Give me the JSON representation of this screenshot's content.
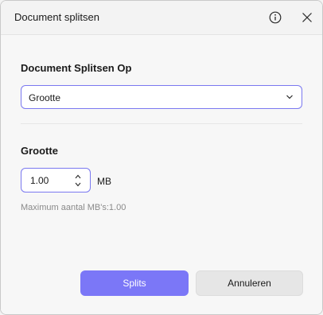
{
  "dialog": {
    "title": "Document splitsen",
    "icons": {
      "info": "info-circle-icon",
      "close": "close-icon"
    }
  },
  "split_by": {
    "label": "Document Splitsen Op",
    "selected": "Grootte"
  },
  "size": {
    "label": "Grootte",
    "value": "1.00",
    "unit": "MB",
    "hint": "Maximum aantal MB's:1.00"
  },
  "buttons": {
    "split": "Splits",
    "cancel": "Annuleren"
  },
  "colors": {
    "accent": "#7b77f7",
    "field_border": "#7a78f0"
  }
}
